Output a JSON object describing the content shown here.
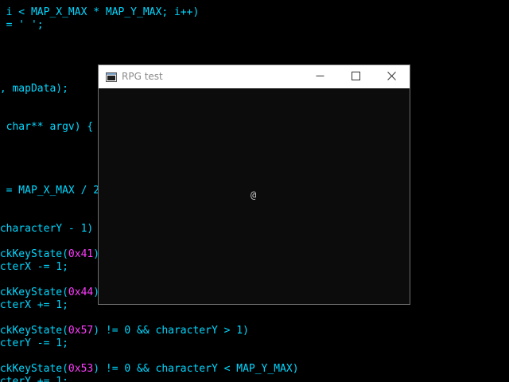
{
  "editor": {
    "lines": [
      {
        "tokens": [
          {
            "t": "; i < MAP_X_MAX * MAP_Y_MAX; i++)",
            "k": "plain"
          }
        ]
      },
      {
        "tokens": [
          {
            "t": "  = ' ';",
            "k": "plain"
          }
        ]
      },
      {
        "tokens": []
      },
      {
        "tokens": []
      },
      {
        "tokens": []
      },
      {
        "tokens": []
      },
      {
        "tokens": [
          {
            "t": "\", mapData);",
            "k": "plain"
          }
        ]
      },
      {
        "tokens": []
      },
      {
        "tokens": []
      },
      {
        "tokens": [
          {
            "t": "  char** argv) {",
            "k": "plain"
          }
        ]
      },
      {
        "tokens": []
      },
      {
        "tokens": []
      },
      {
        "tokens": []
      },
      {
        "tokens": []
      },
      {
        "tokens": [
          {
            "t": "( = MAP_X_MAX / 2",
            "k": "plain"
          }
        ]
      },
      {
        "tokens": []
      },
      {
        "tokens": []
      },
      {
        "tokens": [
          {
            "t": " characterY - 1) =",
            "k": "plain"
          }
        ]
      },
      {
        "tokens": []
      },
      {
        "tokens": [
          {
            "t": " ckKeyState(",
            "k": "plain"
          },
          {
            "t": "0x41",
            "k": "num"
          },
          {
            "t": ")",
            "k": "plain"
          }
        ]
      },
      {
        "tokens": [
          {
            "t": " cterX -= 1;",
            "k": "plain"
          }
        ]
      },
      {
        "tokens": []
      },
      {
        "tokens": [
          {
            "t": " ckKeyState(",
            "k": "plain"
          },
          {
            "t": "0x44",
            "k": "num"
          },
          {
            "t": ")",
            "k": "plain"
          }
        ]
      },
      {
        "tokens": [
          {
            "t": " cterX += 1;",
            "k": "plain"
          }
        ]
      },
      {
        "tokens": []
      },
      {
        "tokens": [
          {
            "t": " ckKeyState(",
            "k": "plain"
          },
          {
            "t": "0x57",
            "k": "num"
          },
          {
            "t": ") != 0 && characterY > 1)",
            "k": "plain"
          }
        ]
      },
      {
        "tokens": [
          {
            "t": " cterY -= 1;",
            "k": "plain"
          }
        ]
      },
      {
        "tokens": []
      },
      {
        "tokens": [
          {
            "t": " ckKeyState(",
            "k": "plain"
          },
          {
            "t": "0x53",
            "k": "num"
          },
          {
            "t": ") != 0 && characterY < MAP_Y_MAX)",
            "k": "plain"
          }
        ]
      },
      {
        "tokens": [
          {
            "t": " cterY += 1;",
            "k": "plain"
          }
        ]
      }
    ]
  },
  "window": {
    "title": "RPG test",
    "icon": "console-app-icon",
    "buttons": {
      "minimize": "minimize-icon",
      "maximize": "maximize-icon",
      "close": "close-icon"
    },
    "content": {
      "player_char": "@"
    }
  },
  "colors": {
    "code_text": "#00d7ff",
    "code_number": "#ff3cff",
    "editor_bg": "#000000",
    "window_client_bg": "#0c0c0c",
    "titlebar_bg": "#ffffff",
    "title_text": "#8a8a8a",
    "player_text": "#cccccc"
  }
}
